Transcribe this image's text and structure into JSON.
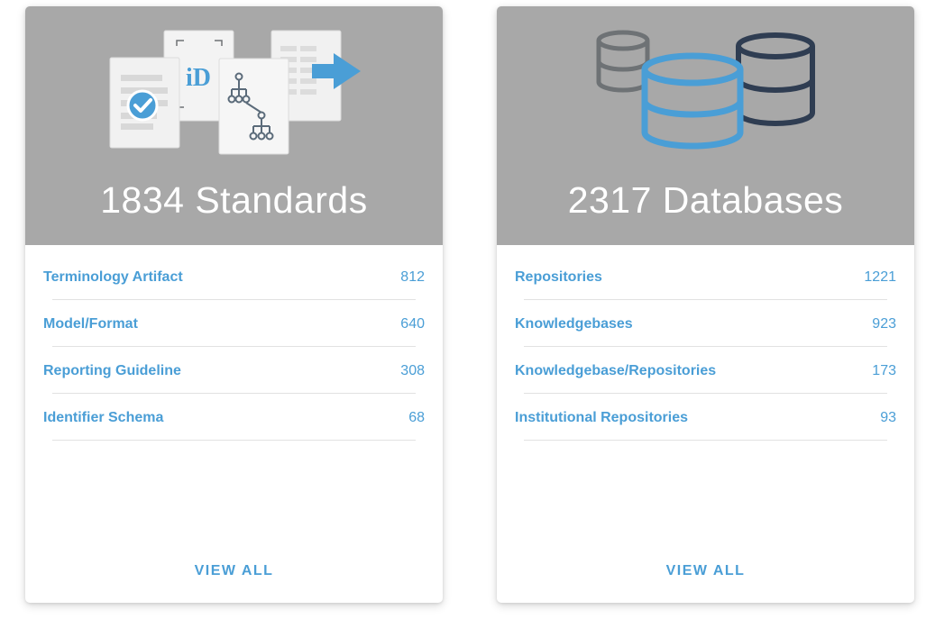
{
  "colors": {
    "header_bg": "#a8a8a8",
    "accent_blue": "#4a9ed6",
    "dark_navy": "#2f3d52",
    "mid_gray": "#6e7275",
    "divider": "#e2e2e2"
  },
  "cards": [
    {
      "title": "1834 Standards",
      "illustration": "standards-documents-illustration",
      "items": [
        {
          "label": "Terminology Artifact",
          "count": "812"
        },
        {
          "label": "Model/Format",
          "count": "640"
        },
        {
          "label": "Reporting Guideline",
          "count": "308"
        },
        {
          "label": "Identifier Schema",
          "count": "68"
        }
      ],
      "view_all_label": "VIEW ALL"
    },
    {
      "title": "2317 Databases",
      "illustration": "database-cylinders-illustration",
      "items": [
        {
          "label": "Repositories",
          "count": "1221"
        },
        {
          "label": "Knowledgebases",
          "count": "923"
        },
        {
          "label": "Knowledgebase/Repositories",
          "count": "173"
        },
        {
          "label": "Institutional Repositories",
          "count": "93"
        }
      ],
      "view_all_label": "VIEW ALL"
    }
  ],
  "icons": {
    "standards": [
      "checklist-document-icon",
      "identifier-document-icon",
      "hierarchy-document-icon",
      "table-export-icon"
    ],
    "databases": [
      "small-database-icon",
      "large-database-icon",
      "dark-database-icon"
    ],
    "id_glyph": "iD"
  }
}
